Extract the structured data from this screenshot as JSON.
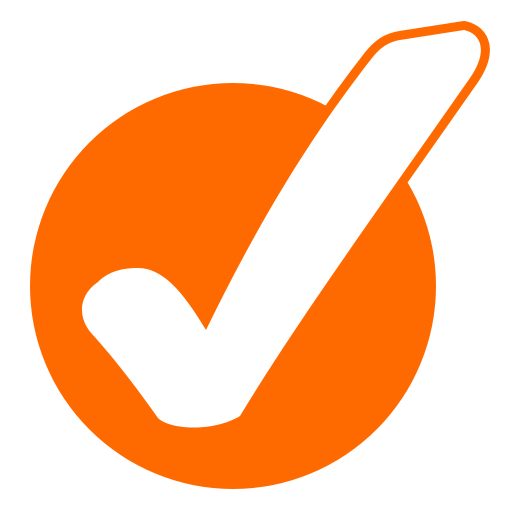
{
  "icon": {
    "name": "checkmark-circle-icon",
    "colors": {
      "accent": "#ff6a00",
      "check_fill": "#ffffff",
      "background": "#ffffff"
    }
  }
}
